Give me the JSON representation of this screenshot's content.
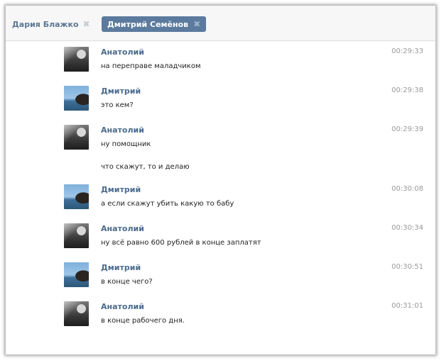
{
  "tabs": [
    {
      "label": "Дария Блажко",
      "close_icon": "close-icon",
      "active": false
    },
    {
      "label": "Дмитрий Семёнов",
      "close_icon": "close-icon",
      "active": true
    }
  ],
  "messages": [
    {
      "sender": "Анатолий",
      "avatar": "avatar-anatoly",
      "time": "00:29:33",
      "lines": [
        "на переправе маладчиком"
      ]
    },
    {
      "sender": "Дмитрий",
      "avatar": "avatar-dmitry",
      "time": "00:29:38",
      "lines": [
        "это кем?"
      ]
    },
    {
      "sender": "Анатолий",
      "avatar": "avatar-anatoly",
      "time": "00:29:39",
      "lines": [
        "ну помощник",
        "что скажут, то и делаю"
      ]
    },
    {
      "sender": "Дмитрий",
      "avatar": "avatar-dmitry",
      "time": "00:30:08",
      "lines": [
        "а если скажут убить какую то бабу"
      ]
    },
    {
      "sender": "Анатолий",
      "avatar": "avatar-anatoly",
      "time": "00:30:34",
      "lines": [
        "ну всё равно 600 рублей в конце заплатят"
      ]
    },
    {
      "sender": "Дмитрий",
      "avatar": "avatar-dmitry",
      "time": "00:30:51",
      "lines": [
        "в конце чего?"
      ]
    },
    {
      "sender": "Анатолий",
      "avatar": "avatar-anatoly",
      "time": "00:31:01",
      "lines": [
        "в конце рабочего дня."
      ]
    }
  ],
  "colors": {
    "tab_active_bg": "#5b7a9e",
    "sender_name": "#4a6b8d",
    "timestamp": "#9a9a9a"
  }
}
